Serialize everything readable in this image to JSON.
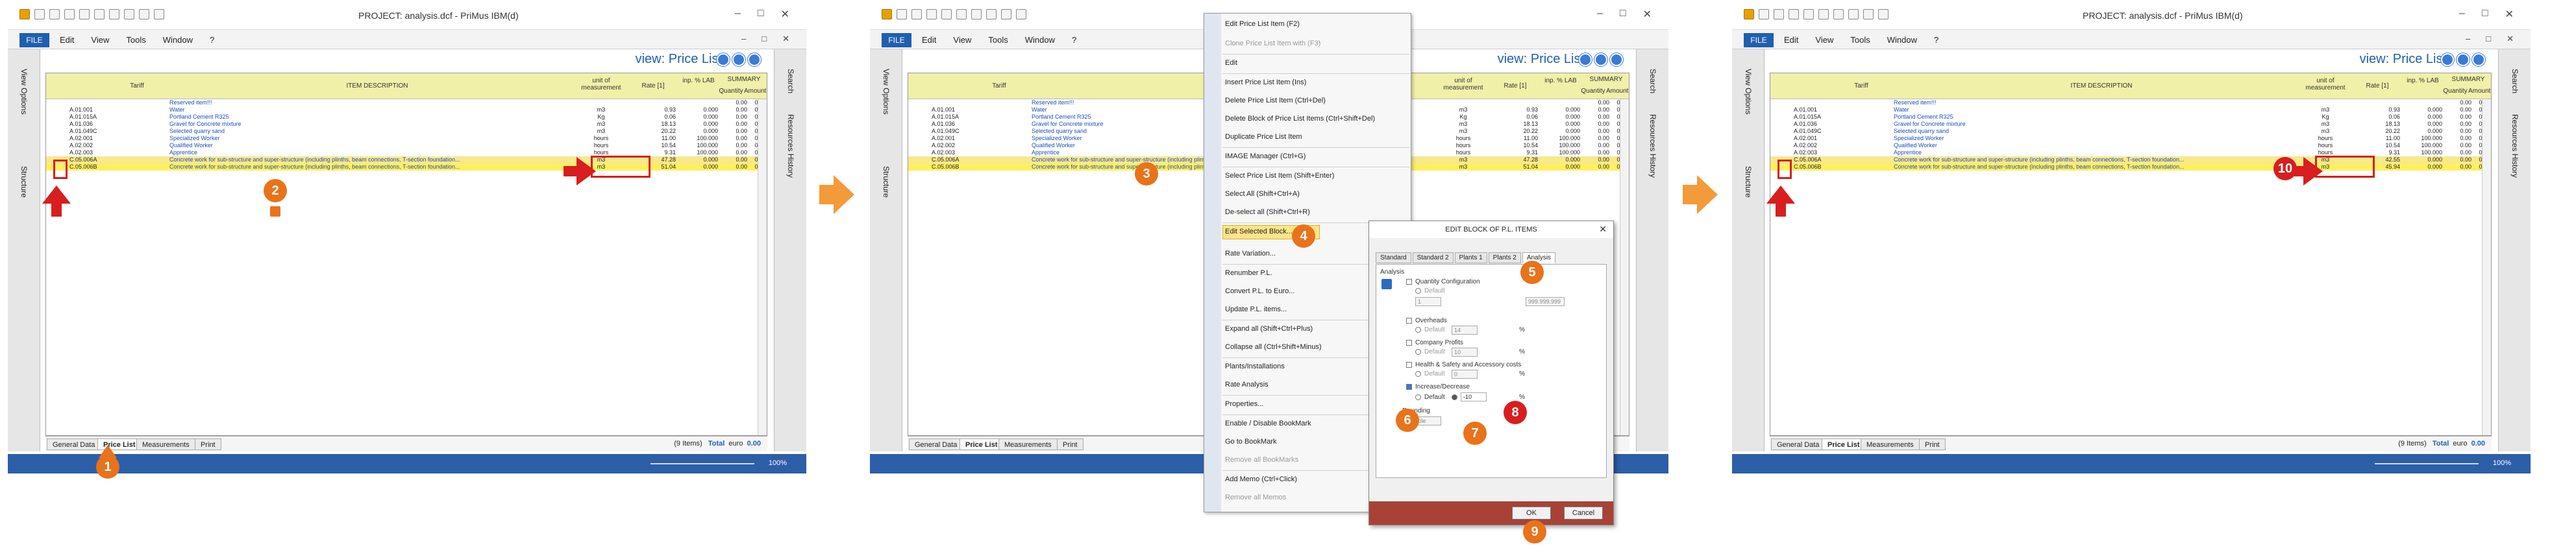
{
  "app": {
    "title": "PROJECT: analysis.dcf - PriMus   IBM(d)",
    "menu": [
      "Edit",
      "View",
      "Tools",
      "Window",
      "?"
    ],
    "file_label": "FILE",
    "view_prefix": "view:",
    "view_name": "Price List"
  },
  "side": {
    "left": [
      "View Options",
      "Structure"
    ],
    "right": [
      "Search",
      "Resources History"
    ]
  },
  "grid": {
    "headers": {
      "tariff": "Tariff",
      "desc": "ITEM DESCRIPTION",
      "unit": "unit of measurement",
      "rate": "Rate [1]",
      "lab": "inp. % LAB",
      "summary": "SUMMARY",
      "qty": "Quantity",
      "amt": "Amount"
    },
    "rows": [
      {
        "code": "",
        "desc": "Reserved item!!!",
        "unit": "",
        "rate": "",
        "lab": "",
        "qty": "0.00",
        "amt": "0.00"
      },
      {
        "code": "A.01.001",
        "desc": "Water",
        "unit": "m3",
        "rate": "0.93",
        "lab": "0.000",
        "qty": "0.00",
        "amt": "0.00"
      },
      {
        "code": "A.01.015A",
        "desc": "Portland Cement R325",
        "unit": "Kg",
        "rate": "0.06",
        "lab": "0.000",
        "qty": "0.00",
        "amt": "0.00"
      },
      {
        "code": "A.01.036",
        "desc": "Gravel for Concrete mixture",
        "unit": "m3",
        "rate": "18.13",
        "lab": "0.000",
        "qty": "0.00",
        "amt": "0.00"
      },
      {
        "code": "A.01.049C",
        "desc": "Selected quarry sand",
        "unit": "m3",
        "rate": "20.22",
        "lab": "0.000",
        "qty": "0.00",
        "amt": "0.00"
      },
      {
        "code": "A.02.001",
        "desc": "Specialized Worker",
        "unit": "hours",
        "rate": "11.00",
        "lab": "100.000",
        "qty": "0.00",
        "amt": "0.00"
      },
      {
        "code": "A.02.002",
        "desc": "Qualified Worker",
        "unit": "hours",
        "rate": "10.54",
        "lab": "100.000",
        "qty": "0.00",
        "amt": "0.00"
      },
      {
        "code": "A.02.003",
        "desc": "Apprentice",
        "unit": "hours",
        "rate": "9.31",
        "lab": "100.000",
        "qty": "0.00",
        "amt": "0.00"
      },
      {
        "code": "C.05.006A",
        "desc": "Concrete work for sub-structure and super-structure (including plinths, beam connections, T-section foundation...",
        "unit": "m3",
        "rate": "47.28",
        "lab": "0.000",
        "qty": "0.00",
        "amt": "0.00"
      },
      {
        "code": "C.05.006B",
        "desc": "Concrete work for sub-structure and super-structure (including plinths, beam connections, T-section foundation...",
        "unit": "m3",
        "rate": "51.04",
        "lab": "0.000",
        "qty": "0.00",
        "amt": "0.00"
      }
    ],
    "rows_after": [
      {
        "rate": "42.55",
        "lab": "0.000"
      },
      {
        "rate": "45.94",
        "lab": "0.000"
      }
    ]
  },
  "sheets": [
    "General Data",
    "Price List",
    "Measurements",
    "Print"
  ],
  "total": {
    "items": "(9 Items)",
    "label": "Total",
    "currency": "euro",
    "value": "0.00"
  },
  "zoom": "100%",
  "context_menu": {
    "items": [
      "Edit Price List Item   (F2)",
      "Clone Price List Item with  (F3)",
      "Edit",
      "Insert Price List Item   (Ins)",
      "Delete Price List Item   (Ctrl+Del)",
      "Delete Block of Price List Items   (Ctrl+Shift+Del)",
      "Duplicate Price List Item",
      "IMAGE Manager   (Ctrl+G)",
      "Select Price List Item   (Shift+Enter)",
      "Select All   (Shift+Ctrl+A)",
      "De-select all   (Shift+Ctrl+R)",
      "Edit Selected Block...",
      "Rate Variation...",
      "Renumber P.L.",
      "Convert P.L. to Euro...",
      "Update P.L. items...",
      "Expand all   (Shift+Ctrl+Plus)",
      "Collapse all   (Ctrl+Shift+Minus)",
      "Plants/Installations",
      "Rate Analysis",
      "Properties...",
      "Enable / Disable BookMark",
      "Go to BookMark",
      "Remove all BookMarks",
      "Add Memo   (Ctrl+Click)",
      "Remove all Memos"
    ]
  },
  "dialog": {
    "title": "EDIT BLOCK OF P.L. ITEMS",
    "close": "✕",
    "tabs": [
      "Standard",
      "Standard 2",
      "Plants 1",
      "Plants 2",
      "Analysis"
    ],
    "section": "Analysis",
    "qty_config": "Quantity Configuration",
    "default": "Default",
    "overheads": "Overheads",
    "company_profits": "Company Profits",
    "hs_costs": "Health & Safety and Accessory costs",
    "incdec": "Increase/Decrease",
    "value": "-10",
    "pct": "%",
    "rounding": "Rounding",
    "variable": "Variable",
    "qty_fld1": "1",
    "qty_fld2": "999.999.999",
    "ohd": "14",
    "prf": "10",
    "hsc": "0",
    "ok": "OK",
    "cancel": "Cancel"
  },
  "callouts": [
    "1",
    "2",
    "3",
    "4",
    "5",
    "6",
    "7",
    "8",
    "9",
    "10"
  ],
  "colors": {
    "accent": "#1f5fb0",
    "callout": "#e8731a",
    "marker": "#d81e1e",
    "highlight": "#f7e98e"
  }
}
